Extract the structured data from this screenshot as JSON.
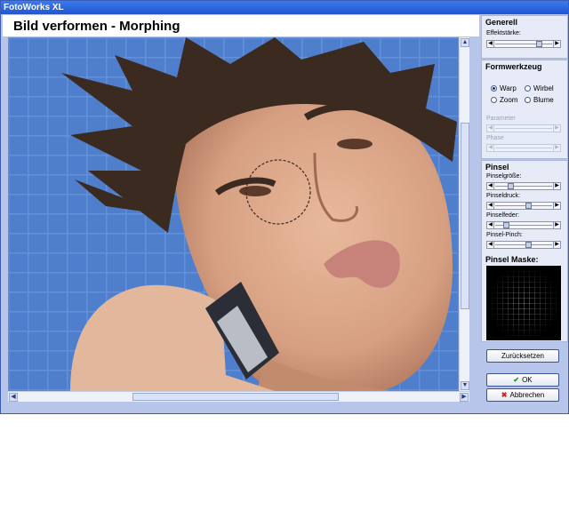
{
  "window": {
    "title": "FotoWorks XL"
  },
  "header": {
    "title": "Bild verformen - Morphing"
  },
  "panel": {
    "generell": {
      "title": "Generell",
      "effektstaerke": {
        "label": "Effektstärke:",
        "value": 0.8
      }
    },
    "formwerkzeug": {
      "title": "Formwerkzeug",
      "options": [
        "Warp",
        "Wirbel",
        "Zoom",
        "Blume"
      ],
      "selected": "Warp",
      "param1_label": "Parameter",
      "param2_label": "Phase"
    },
    "pinsel": {
      "title": "Pinsel",
      "sliders": [
        {
          "label": "Pinselgröße:",
          "value": 0.25
        },
        {
          "label": "Pinseldruck:",
          "value": 0.6
        },
        {
          "label": "Pinselfeder:",
          "value": 0.15
        },
        {
          "label": "Pinsel-Pinch:",
          "value": 0.6
        }
      ],
      "mask_label": "Pinsel Maske:"
    },
    "buttons": {
      "reset": "Zurücksetzen",
      "ok": "OK",
      "cancel": "Abbrechen"
    }
  },
  "colors": {
    "titlebar": "#2a62de",
    "frame": "#b7c5ea",
    "ok_icon": "#1a9a1a",
    "cancel_icon": "#d02020"
  },
  "icons": {
    "ok": "check-icon",
    "cancel": "x-icon"
  }
}
